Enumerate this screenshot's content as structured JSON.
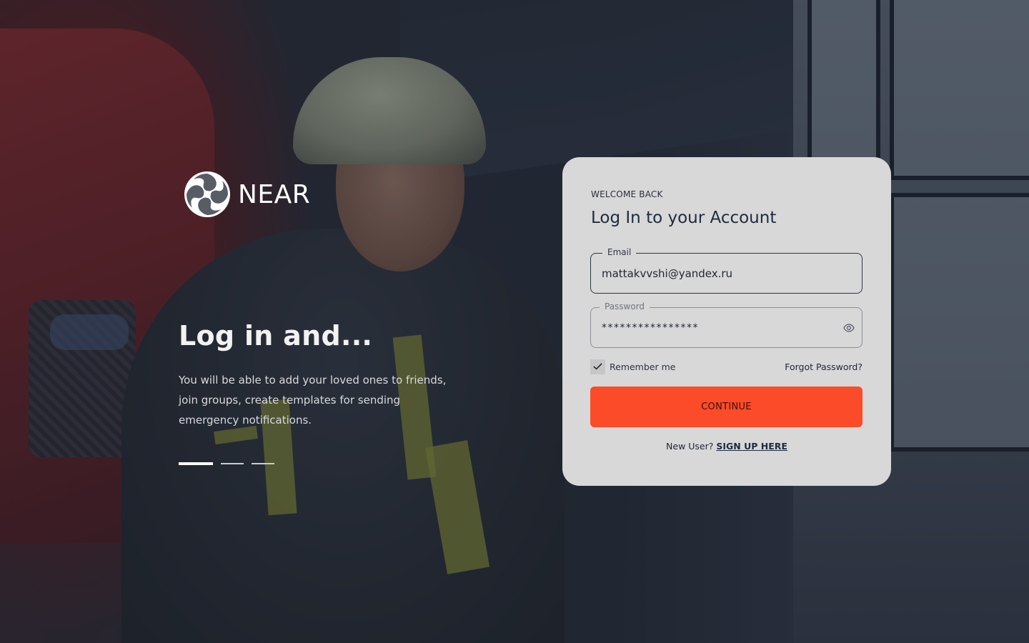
{
  "brand": {
    "name": "NEAR",
    "logo_icon": "near-swirl-logo-icon"
  },
  "hero": {
    "title": "Log in and...",
    "text": "You will be able to add your loved ones to friends, join groups, create templates for sending emergency notifications.",
    "carousel": {
      "total": 3,
      "active": 1
    }
  },
  "login": {
    "eyebrow": "WELCOME BACK",
    "title": "Log In to your Account",
    "email": {
      "label": "Email",
      "value": "mattakvvshi@yandex.ru"
    },
    "password": {
      "label": "Password",
      "value": "****************",
      "toggle_icon": "eye-icon"
    },
    "remember_label": "Remember me",
    "remember_checked": true,
    "forgot_label": "Forgot Password?",
    "continue_label": "CONTINUE",
    "signup_prompt": "New User?",
    "signup_link": "SIGN UP HERE"
  },
  "colors": {
    "accent": "#fb4b29",
    "card_bg": "#d8d8d8",
    "title_text": "#1d2b3f"
  }
}
